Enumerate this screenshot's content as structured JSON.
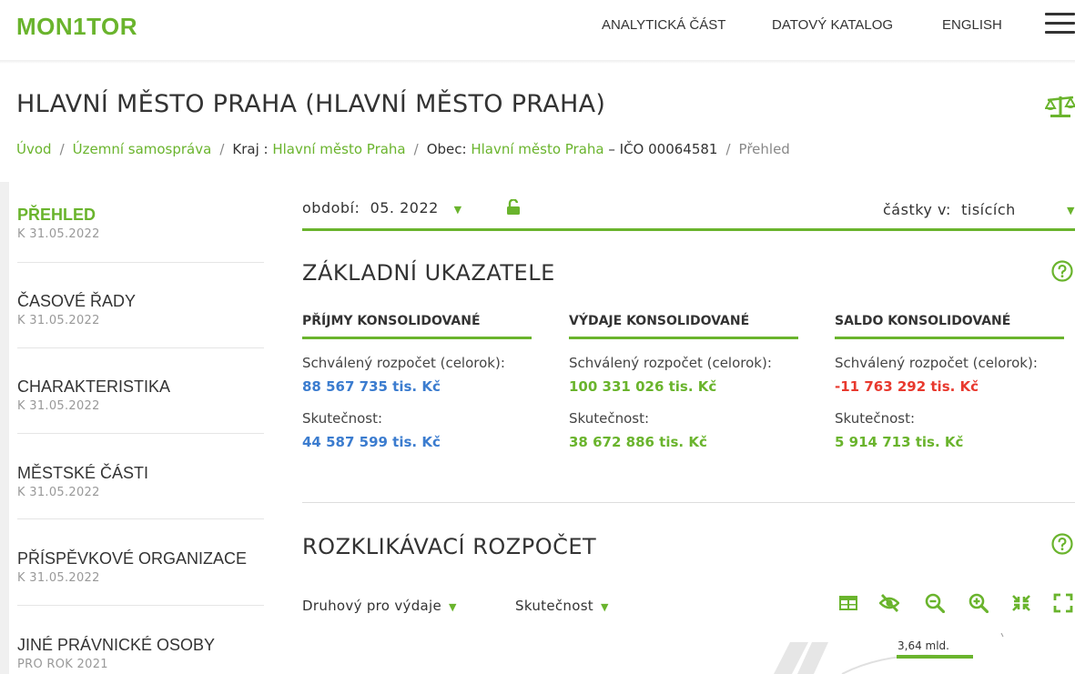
{
  "header": {
    "logo": "MON1TOR",
    "nav": [
      "ANALYTICKÁ ČÁST",
      "DATOVÝ KATALOG",
      "ENGLISH"
    ]
  },
  "page": {
    "title": "HLAVNÍ MĚSTO PRAHA (HLAVNÍ MĚSTO PRAHA)"
  },
  "breadcrumb": {
    "home": "Úvod",
    "territorial": "Územní samospráva",
    "region_label": "Kraj : ",
    "region": "Hlavní město Praha",
    "municipality_label": "Obec: ",
    "municipality": "Hlavní město Praha",
    "ico": "– IČO 00064581",
    "current": "Přehled"
  },
  "sidebar": {
    "items": [
      {
        "label": "PŘEHLED",
        "sub": "K 31.05.2022"
      },
      {
        "label": "ČASOVÉ ŘADY",
        "sub": "K 31.05.2022"
      },
      {
        "label": "CHARAKTERISTIKA",
        "sub": "K 31.05.2022"
      },
      {
        "label": "MĚSTSKÉ ČÁSTI",
        "sub": "K 31.05.2022"
      },
      {
        "label": "PŘÍSPĚVKOVÉ ORGANIZACE",
        "sub": "K 31.05.2022"
      },
      {
        "label": "JINÉ PRÁVNICKÉ OSOBY",
        "sub": "PRO ROK 2021"
      }
    ]
  },
  "controls": {
    "period_label": "období:",
    "period_value": "05. 2022",
    "amounts_label": "částky v:",
    "amounts_value": "tisících"
  },
  "indicators": {
    "heading": "ZÁKLADNÍ UKAZATELE",
    "columns": [
      {
        "title": "PŘÍJMY KONSOLIDOVANÉ",
        "budget_label": "Schválený rozpočet (celorok):",
        "budget_value": "88 567 735 tis. Kč",
        "actual_label": "Skutečnost:",
        "actual_value": "44 587 599 tis. Kč"
      },
      {
        "title": "VÝDAJE KONSOLIDOVANÉ",
        "budget_label": "Schválený rozpočet (celorok):",
        "budget_value": "100 331 026 tis. Kč",
        "actual_label": "Skutečnost:",
        "actual_value": "38 672 886 tis. Kč"
      },
      {
        "title": "SALDO KONSOLIDOVANÉ",
        "budget_label": "Schválený rozpočet (celorok):",
        "budget_value": "-11 763 292 tis. Kč",
        "actual_label": "Skutečnost:",
        "actual_value": "5 914 713 tis. Kč"
      }
    ]
  },
  "budget": {
    "heading": "ROZKLIKÁVACÍ ROZPOČET",
    "type_dropdown": "Druhový pro výdaje",
    "value_dropdown": "Skutečnost",
    "chart_label": "3,64 mld."
  },
  "colors": {
    "brand_green": "#6ab42d",
    "value_blue": "#3b7ccf",
    "value_red": "#e8392e"
  },
  "icons": [
    "scales-icon",
    "lock-open-icon",
    "help-icon",
    "table-icon",
    "eye-off-icon",
    "zoom-out-icon",
    "zoom-in-icon",
    "collapse-icon",
    "expand-icon"
  ]
}
